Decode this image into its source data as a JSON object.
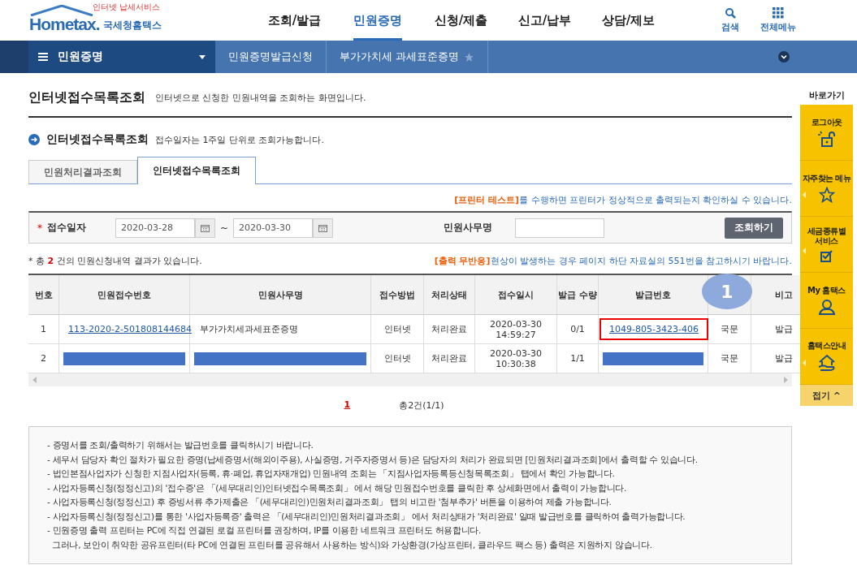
{
  "header": {
    "logo": {
      "tagline": "인터넷 납세서비스",
      "wordmark": "Hometax.",
      "name": "국세청홈택스"
    },
    "menu": [
      {
        "label": "조회/발급",
        "selected": false
      },
      {
        "label": "민원증명",
        "selected": true
      },
      {
        "label": "신청/제출",
        "selected": false
      },
      {
        "label": "신고/납부",
        "selected": false
      },
      {
        "label": "상담/제보",
        "selected": false
      }
    ],
    "tools": [
      {
        "kind": "search",
        "label": "검색"
      },
      {
        "kind": "grid",
        "label": "전체메뉴"
      }
    ]
  },
  "navbar": {
    "section": "민원증명",
    "breadcrumbs": [
      "민원증명발급신청",
      "부가가치세 과세표준증명"
    ],
    "favorite": false
  },
  "page": {
    "title": "인터넷접수목록조회",
    "subtitle": "인터넷으로 신청한 민원내역을 조회하는 화면입니다."
  },
  "section": {
    "title": "인터넷접수목록조회",
    "note": "접수일자는 1주일 단위로 조회가능합니다."
  },
  "tabs": [
    {
      "label": "민원처리결과조회",
      "selected": false
    },
    {
      "label": "인터넷접수목록조회",
      "selected": true
    }
  ],
  "printer_notice": {
    "link": "[프린터 테스트]",
    "text": "를 수행하면 프린터가 정상적으로 출력되는지 확인하실 수 있습니다."
  },
  "search": {
    "date_label": "접수일자",
    "required_mark": "*",
    "from": "2020-03-28",
    "separator": "~",
    "to": "2020-03-30",
    "name_label": "민원사무명",
    "button": "조회하기"
  },
  "result_summary": {
    "prefix": "* 총",
    "count": "2",
    "suffix": "건의 민원신청내역 결과가 있습니다."
  },
  "output_notice": {
    "link": "[출력 무반응]",
    "text": "현상이 발생하는 경우 페이지 하단 자료실의 551번을 참고하시기 바랍니다."
  },
  "table": {
    "columns": [
      {
        "label": "번호"
      },
      {
        "label": "민원접수번호"
      },
      {
        "label": "민원사무명"
      },
      {
        "label": "접수방법"
      },
      {
        "label": "처리상태"
      },
      {
        "label": "접수일시"
      },
      {
        "label": "발급 수량"
      },
      {
        "label": "발급번호"
      },
      {
        "kind": "blank"
      },
      {
        "label": "비고"
      }
    ],
    "rows": [
      {
        "cells": [
          {
            "kind": "text",
            "text": "1"
          },
          {
            "kind": "link",
            "text": "113-2020-2-501808144684"
          },
          {
            "kind": "left_text",
            "text": "부가가치세과세표준증명"
          },
          {
            "kind": "text",
            "text": "인터넷"
          },
          {
            "kind": "text",
            "text": "처리완료"
          },
          {
            "kind": "text",
            "text": "2020-03-30 14:59:27"
          },
          {
            "kind": "text",
            "text": "0/1"
          },
          {
            "kind": "link",
            "text": "1049-805-3423-406",
            "highlighted": true
          },
          {
            "kind": "text",
            "text": "국문"
          },
          {
            "kind": "text",
            "text": "발급"
          }
        ]
      },
      {
        "cells": [
          {
            "kind": "text",
            "text": "2"
          },
          {
            "kind": "redacted"
          },
          {
            "kind": "redacted"
          },
          {
            "kind": "text",
            "text": "인터넷"
          },
          {
            "kind": "text",
            "text": "처리완료"
          },
          {
            "kind": "text",
            "text": "2020-03-30 10:30:38"
          },
          {
            "kind": "text",
            "text": "1/1"
          },
          {
            "kind": "redacted"
          },
          {
            "kind": "text",
            "text": "국문"
          },
          {
            "kind": "text",
            "text": "발급"
          }
        ]
      }
    ],
    "callout": "1"
  },
  "pagination": {
    "pages": [
      {
        "label": "1",
        "selected": true
      }
    ],
    "total": "총2건(1/1)"
  },
  "notes": [
    "- 증명서를 조회/출력하기 위해서는 발급번호를 클릭하시기 바랍니다.",
    "- 세무서 담당자 확인 절차가 필요한 증명(납세증명서(해외이주용), 사실증명, 거주자증명서 등)은 담당자의 처리가 완료되면 [민원처리결과조회]에서 출력할 수 있습니다.",
    "- 법인본점사업자가 신청한 지점사업자(등록, 휴·폐업, 휴업자재개업) 민원내역 조회는 「지점사업자등록등신청목록조회」 탭에서 확인 가능합니다.",
    "- 사업자등록신청(정정신고)의 '접수증'은 「(세무대리인)인터넷접수목록조회」 에서 해당 민원접수번호를 클릭한 후 상세화면에서 출력이 가능합니다.",
    "- 사업자등록신청(정정신고) 후 증빙서류 추가제출은 「(세무대리인)민원처리결과조회」 탭의 비고란 '첨부추가' 버튼을 이용하여 제출 가능합니다.",
    "- 사업자등록신청(정정신고)를 통한 '사업자등록증' 출력은 「(세무대리인)민원처리결과조회」 에서 처리상태가 '처리완료' 일때 발급번호를 클릭하여 출력가능합니다.",
    "- 민원증명 출력 프린터는 PC에 직접 연결된 로컬 프린터를 권장하며, IP를 이용한 네트워크 프린터도 허용합니다.",
    "  그러나, 보안이 취약한 공유프린터(타 PC에 연결된 프린터를 공유해서 사용하는 방식)와 가상환경(가상프린터, 클라우드 팩스 등) 출력은 지원하지 않습니다."
  ],
  "quickbar": {
    "title": "바로가기",
    "items": [
      {
        "kind": "logout",
        "label": "로그아웃",
        "expandable": false
      },
      {
        "kind": "star",
        "label": "자주찾는 메뉴",
        "expandable": true
      },
      {
        "kind": "check",
        "label": "세금종류별 서비스",
        "expandable": true
      },
      {
        "kind": "person",
        "label": "My 홈택스",
        "expandable": false
      },
      {
        "kind": "house",
        "label": "홈택스안내",
        "expandable": true
      }
    ],
    "collapse": "접기 ^"
  }
}
